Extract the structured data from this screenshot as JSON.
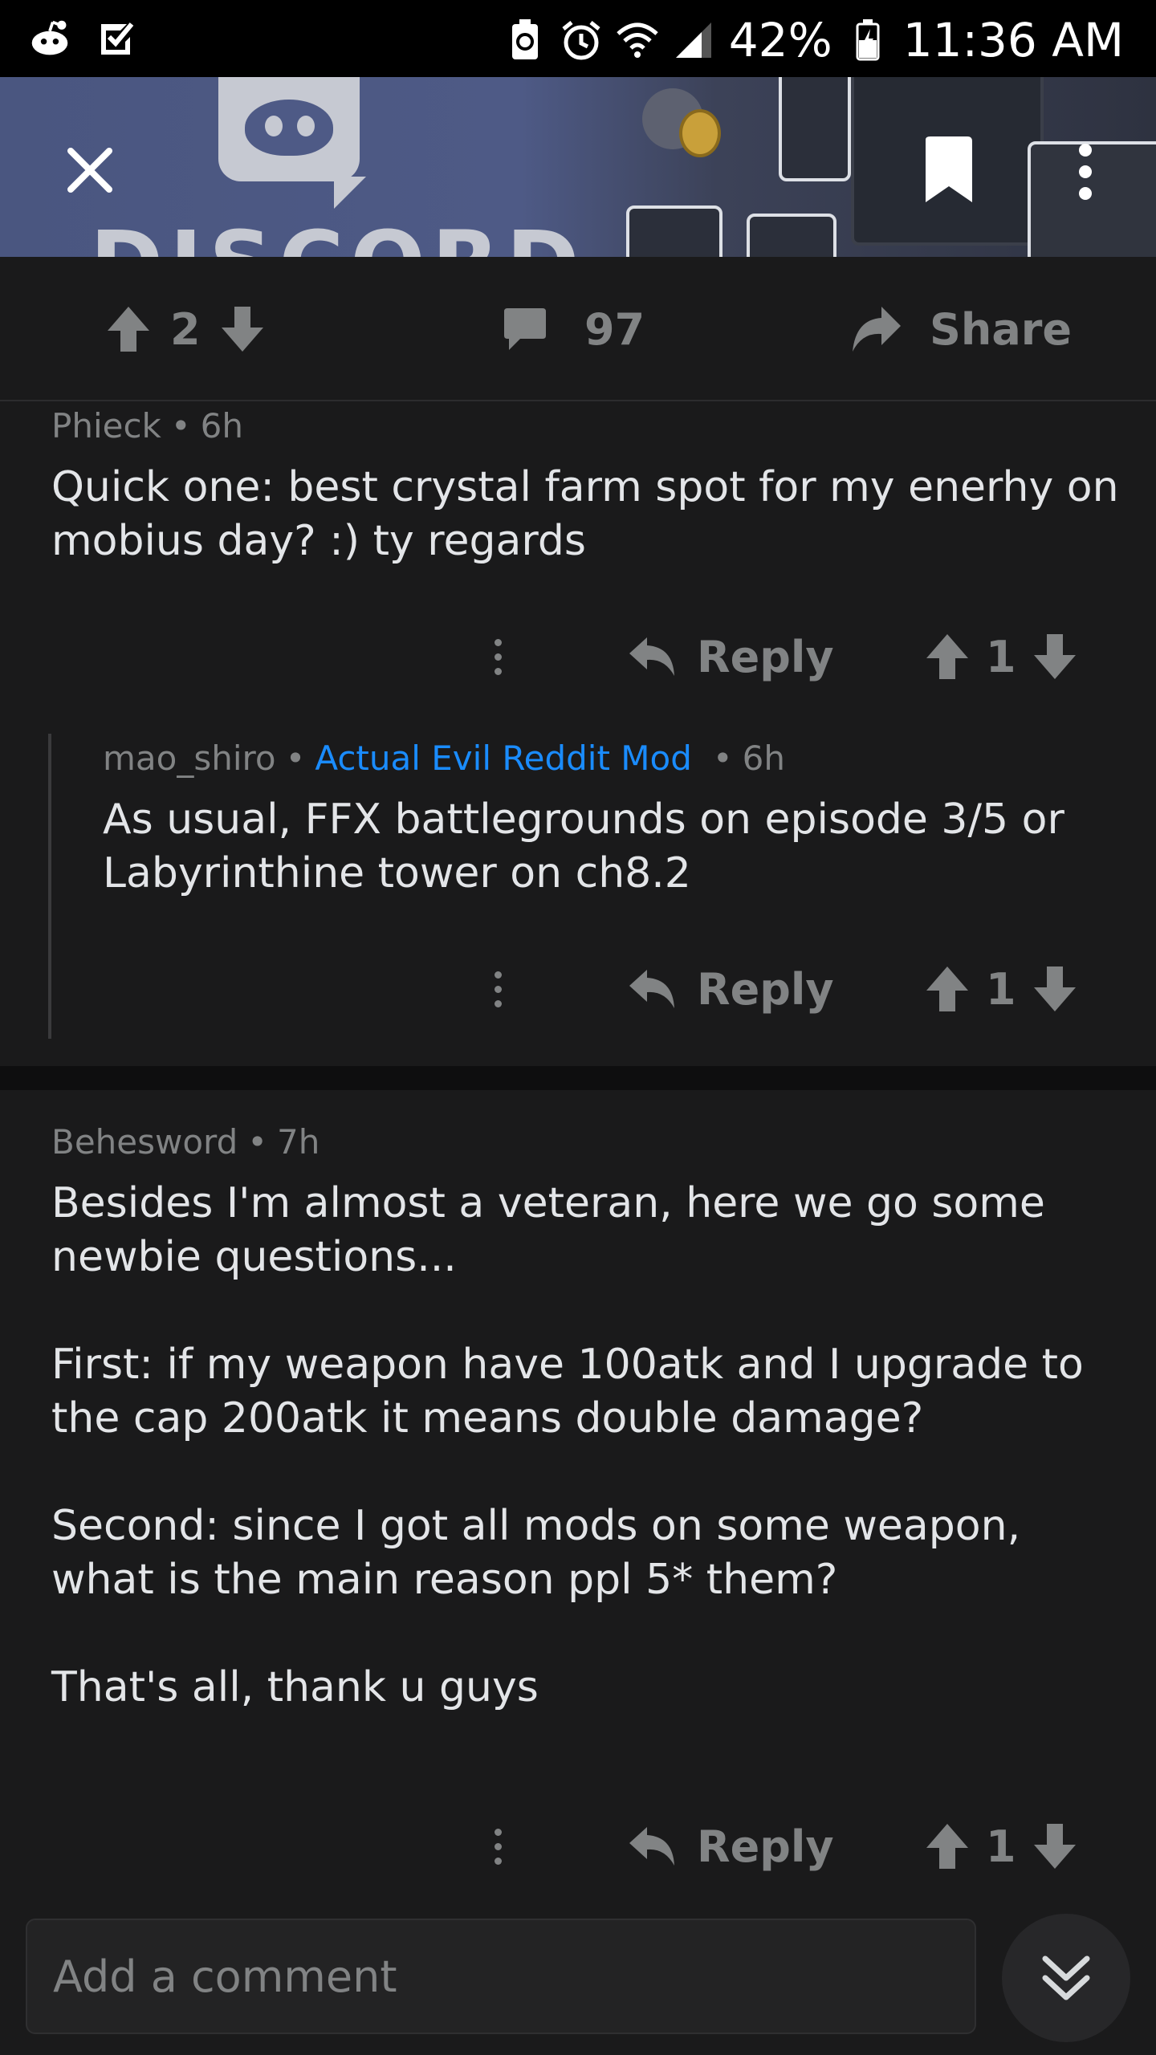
{
  "status_bar": {
    "battery": "42%",
    "time": "11:36 AM",
    "icons": [
      "reddit-icon",
      "checkmark-icon",
      "battery-saver-icon",
      "alarm-icon",
      "wifi-icon",
      "signal-icon",
      "battery-icon"
    ]
  },
  "banner": {
    "title": "DISCORD",
    "close_icon": "close-icon",
    "bookmark_icon": "bookmark-icon",
    "more_icon": "more-vertical-icon"
  },
  "action_bar": {
    "score": "2",
    "comment_count": "97",
    "share_label": "Share"
  },
  "comments": [
    {
      "author": "Phieck",
      "time": "6h",
      "body": "Quick one: best crystal farm spot for my enerhy on mobius day? :) ty regards",
      "reply_label": "Reply",
      "score": "1"
    },
    {
      "author": "mao_shiro",
      "flair": "Actual Evil Reddit Mod",
      "time": "6h",
      "body": "As usual, FFX battlegrounds on episode 3/5 or Labyrinthine tower on ch8.2",
      "reply_label": "Reply",
      "score": "1"
    },
    {
      "author": "Behesword",
      "time": "7h",
      "body": "Besides I'm almost a veteran, here we go some newbie questions...\n\nFirst: if my weapon have 100atk and I upgrade to the cap 200atk it means double damage?\n\nSecond: since I got all mods on some weapon, what is the main reason ppl 5* them?\n\nThat's all, thank u guys",
      "reply_label": "Reply",
      "score": "1"
    }
  ],
  "comment_bar": {
    "placeholder": "Add a comment"
  },
  "colors": {
    "background": "#1a1a1b",
    "flair": "#1a8cff",
    "muted": "#818384"
  }
}
